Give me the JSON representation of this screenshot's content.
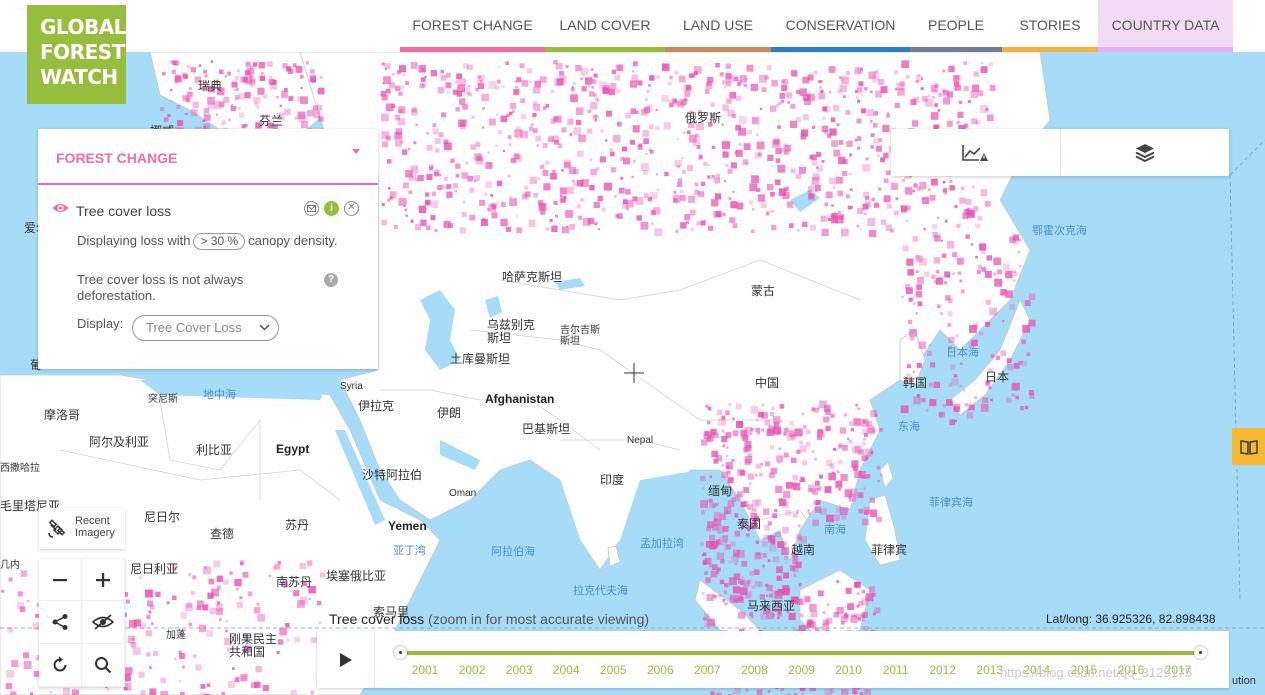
{
  "logo": {
    "line1": "GLOBAL",
    "line2": "FOREST",
    "line3": "WATCH"
  },
  "nav": [
    {
      "label": "FOREST CHANGE",
      "color": "#f06ca2"
    },
    {
      "label": "LAND COVER",
      "color": "#97bd3d"
    },
    {
      "label": "LAND USE",
      "color": "#c9885b"
    },
    {
      "label": "CONSERVATION",
      "color": "#2a7ec5"
    },
    {
      "label": "PEOPLE",
      "color": "#707d92"
    },
    {
      "label": "STORIES",
      "color": "#f4b144"
    },
    {
      "label": "COUNTRY DATA",
      "color": "#e8aaf0"
    }
  ],
  "panel": {
    "title": "FOREST CHANGE",
    "layer_name": "Tree cover loss",
    "desc_prefix": "Displaying loss with",
    "threshold": "> 30 %",
    "desc_suffix": "canopy density.",
    "note": "Tree cover loss is not always deforestation.",
    "display_label": "Display:",
    "display_value": "Tree Cover Loss",
    "accent": "#f06ca2"
  },
  "recent_imagery": {
    "label": "Recent Imagery"
  },
  "timeline": {
    "caption": "Tree cover loss",
    "caption_sub": "(zoom in for most accurate viewing)",
    "years": [
      "2001",
      "2002",
      "2003",
      "2004",
      "2005",
      "2006",
      "2007",
      "2008",
      "2009",
      "2010",
      "2011",
      "2012",
      "2013",
      "2014",
      "2015",
      "2016",
      "2017"
    ],
    "color": "#97bd3d"
  },
  "latlong": "Lat/long: 36.925326, 82.898438",
  "attribution": "https://blog.csdn.net/qq_3129175",
  "attribution_tail": "ution",
  "map_labels": {
    "sweden": "瑞典",
    "finland": "芬兰",
    "norway": "挪威",
    "russia": "俄罗斯",
    "ireland": "爱尔",
    "okhotsk": "鄂霍次克海",
    "kazakhstan": "哈萨克斯坦",
    "mongolia": "蒙古",
    "uzbekistan": "乌兹别克斯坦",
    "kyrgyzstan": "吉尔吉斯斯坦",
    "turkmenistan": "土库曼斯坦",
    "portugal": "葡",
    "mediterranean": "地中海",
    "tunisia": "突尼斯",
    "syria": "Syria",
    "iraq": "伊拉克",
    "iran": "伊朗",
    "afghanistan": "Afghanistan",
    "pakistan": "巴基斯坦",
    "china": "中国",
    "korea": "韩国",
    "japan": "日本",
    "sea_of_japan": "日本海",
    "east_china_sea": "东海",
    "morocco": "摩洛哥",
    "algeria": "阿尔及利亚",
    "libya": "利比亚",
    "egypt": "Egypt",
    "western_sahara": "西撒哈拉",
    "saudi": "沙特阿拉伯",
    "nepal": "Nepal",
    "india": "印度",
    "oman": "Oman",
    "myanmar": "缅甸",
    "philippine_sea": "菲律宾海",
    "mauritania": "毛里塔尼亚",
    "niger": "尼日尔",
    "chad": "查德",
    "sudan": "苏丹",
    "yemen": "Yemen",
    "thailand": "泰国",
    "south_china_sea": "南海",
    "gulf_aden": "亚丁湾",
    "arabian_sea": "阿拉伯海",
    "bay_bengal": "孟加拉湾",
    "vietnam": "越南",
    "philippines": "菲律宾",
    "nigeria": "尼日利亚",
    "south_sudan": "南苏丹",
    "ethiopia": "埃塞俄比亚",
    "laccadive": "拉克代夫海",
    "malaysia": "马来西亚",
    "somalia": "索马里",
    "gabon": "加蓬",
    "drc": "刚果民主共和国",
    "guinea": "几内"
  }
}
